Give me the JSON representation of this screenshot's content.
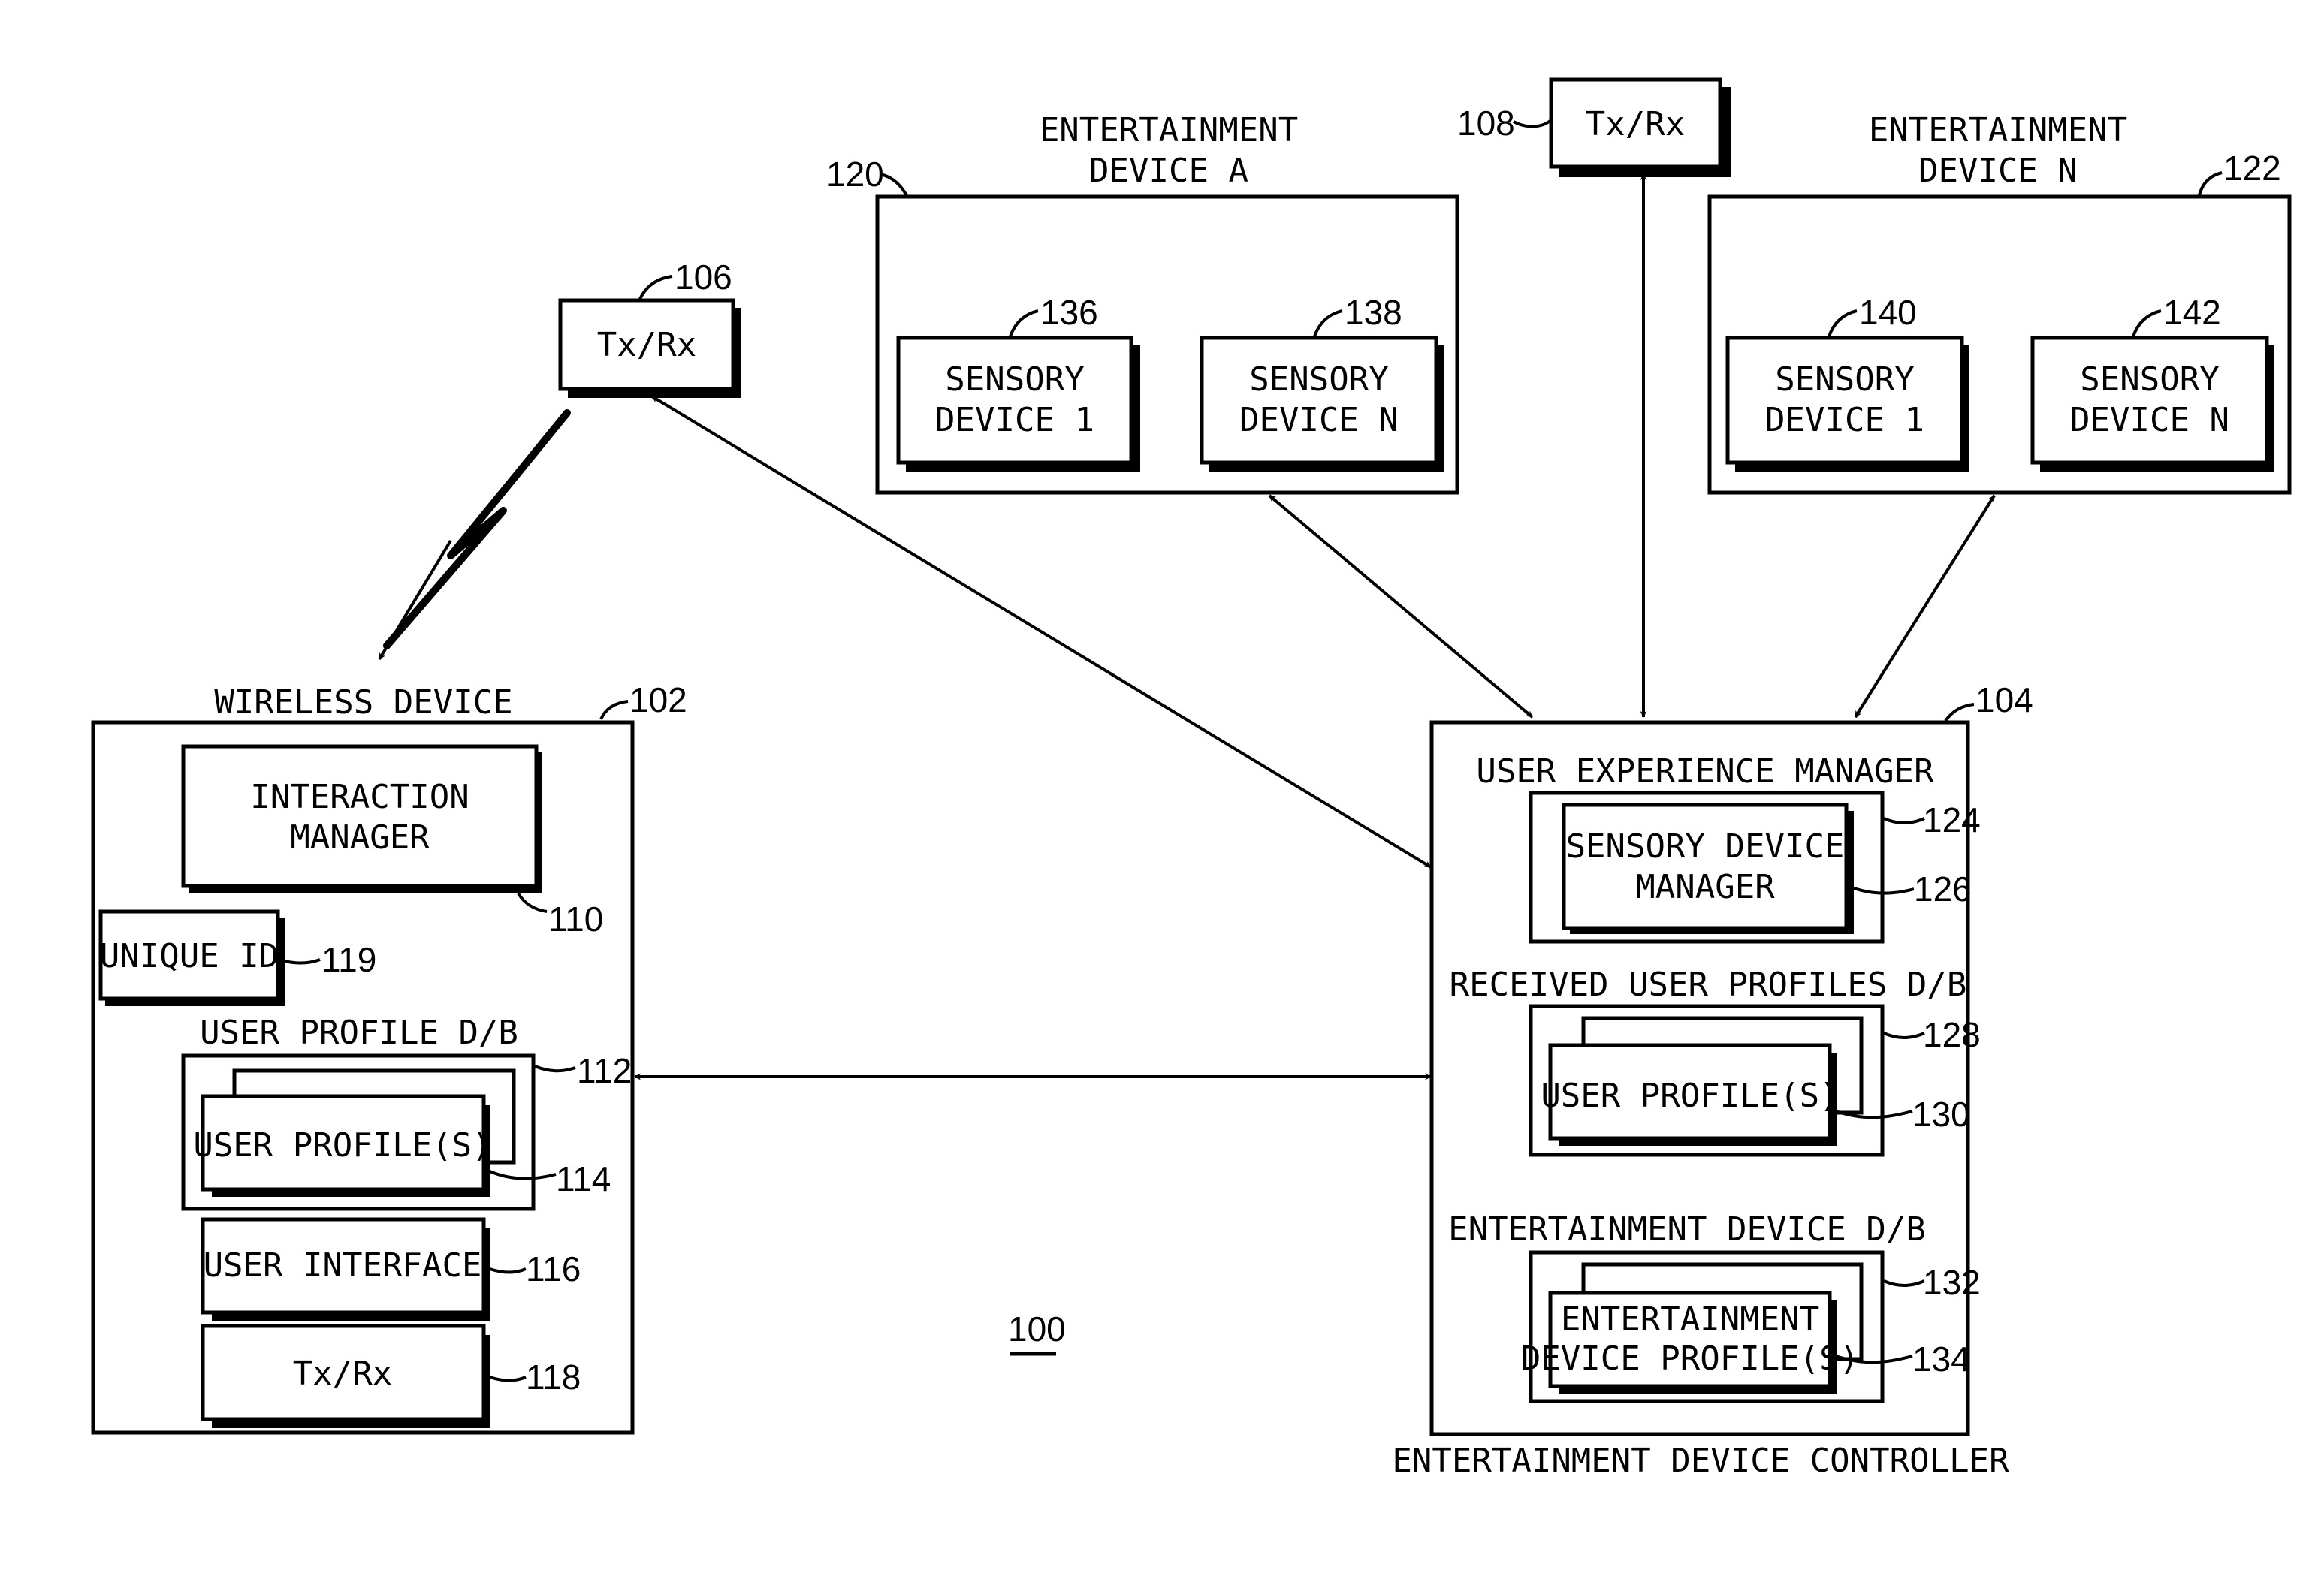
{
  "figure": {
    "ref": "100",
    "colors": {
      "line": "#000000",
      "background": "#ffffff"
    }
  },
  "wireless_device": {
    "title": "WIRELESS DEVICE",
    "ref": "102",
    "interaction_manager": {
      "lines": [
        "INTERACTION",
        "MANAGER"
      ],
      "ref": "110"
    },
    "unique_id": {
      "label": "UNIQUE ID",
      "ref": "119"
    },
    "user_profile_db": {
      "title": "USER PROFILE D/B",
      "ref": "112",
      "profiles_label": "USER PROFILE(S)",
      "profiles_ref": "114"
    },
    "user_interface": {
      "label": "USER INTERFACE",
      "ref": "116"
    },
    "txrx": {
      "label": "Tx/Rx",
      "ref": "118"
    }
  },
  "txrx_106": {
    "label": "Tx/Rx",
    "ref": "106"
  },
  "txrx_108": {
    "label": "Tx/Rx",
    "ref": "108"
  },
  "entertainment_device_a": {
    "title_lines": [
      "ENTERTAINMENT",
      "DEVICE A"
    ],
    "ref": "120",
    "sensory_devices": [
      {
        "lines": [
          "SENSORY",
          "DEVICE 1"
        ],
        "ref": "136"
      },
      {
        "lines": [
          "SENSORY",
          "DEVICE N"
        ],
        "ref": "138"
      }
    ]
  },
  "entertainment_device_n": {
    "title_lines": [
      "ENTERTAINMENT",
      "DEVICE N"
    ],
    "ref": "122",
    "sensory_devices": [
      {
        "lines": [
          "SENSORY",
          "DEVICE 1"
        ],
        "ref": "140"
      },
      {
        "lines": [
          "SENSORY",
          "DEVICE N"
        ],
        "ref": "142"
      }
    ]
  },
  "controller": {
    "title": "ENTERTAINMENT DEVICE CONTROLLER",
    "ref": "104",
    "user_experience_manager": {
      "title": "USER EXPERIENCE MANAGER",
      "ref": "124",
      "sdm_lines": [
        "SENSORY DEVICE",
        "MANAGER"
      ],
      "sdm_ref": "126"
    },
    "received_profiles_db": {
      "title": "RECEIVED USER PROFILES D/B",
      "ref": "128",
      "profiles_label": "USER PROFILE(S)",
      "profiles_ref": "130"
    },
    "entertainment_device_db": {
      "title": "ENTERTAINMENT DEVICE D/B",
      "ref": "132",
      "profiles_lines": [
        "ENTERTAINMENT",
        "DEVICE PROFILE(S)"
      ],
      "profiles_ref": "134"
    }
  }
}
